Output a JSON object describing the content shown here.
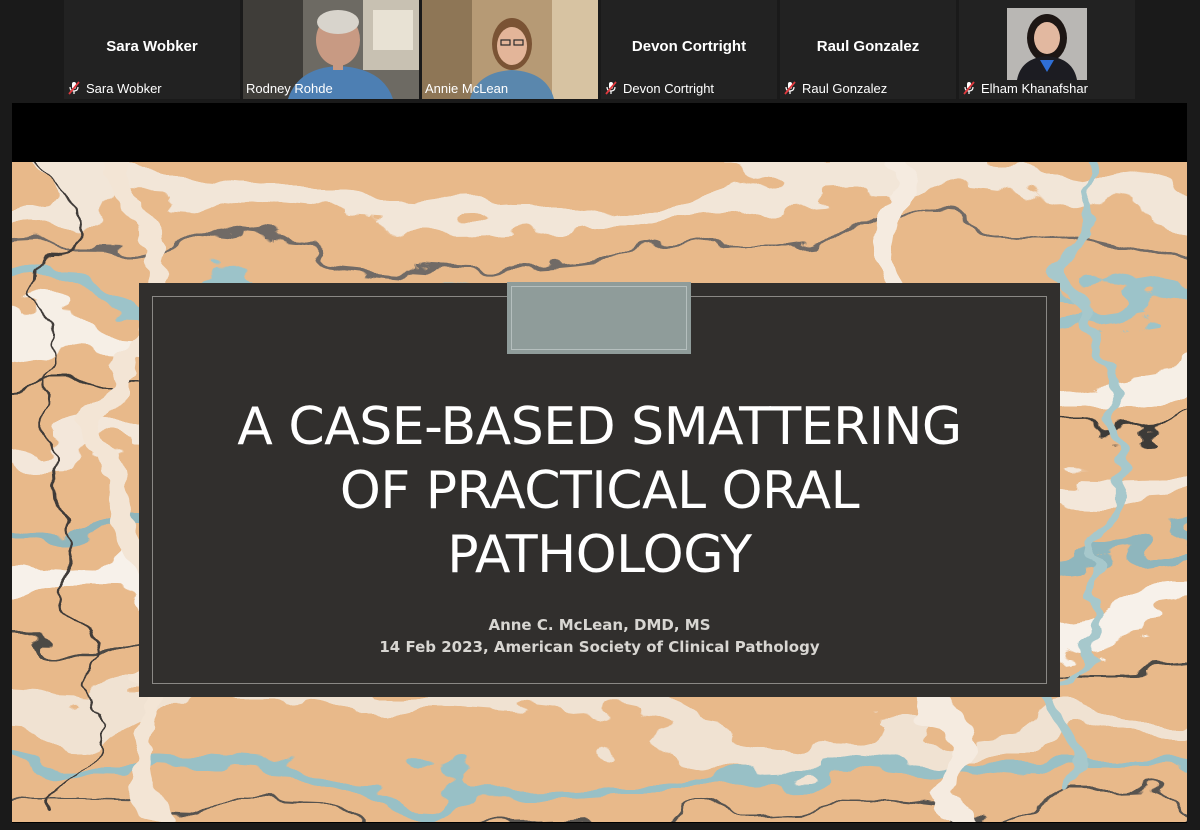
{
  "participants": [
    {
      "name": "Sara Wobker",
      "video": false,
      "muted": true,
      "active": false
    },
    {
      "name": "Rodney Rohde",
      "video": true,
      "muted": false,
      "active": true
    },
    {
      "name": "Annie McLean",
      "video": true,
      "muted": false,
      "active": false
    },
    {
      "name": "Devon Cortright",
      "video": false,
      "muted": true,
      "active": false
    },
    {
      "name": "Raul Gonzalez",
      "video": false,
      "muted": true,
      "active": false
    },
    {
      "name": "Elham Khanafshar",
      "video": true,
      "muted": true,
      "active": false
    }
  ],
  "slide": {
    "title_line1": "A CASE-BASED SMATTERING",
    "title_line2": "OF PRACTICAL ORAL",
    "title_line3": "PATHOLOGY",
    "author": "Anne C. McLean, DMD, MS",
    "event": "14 Feb 2023, American Society of Clinical Pathology"
  },
  "colors": {
    "active_speaker": "#62b34d",
    "muted_icon": "#e0393e",
    "panel": "#312f2d",
    "accent_block": "#8f9c9a"
  }
}
